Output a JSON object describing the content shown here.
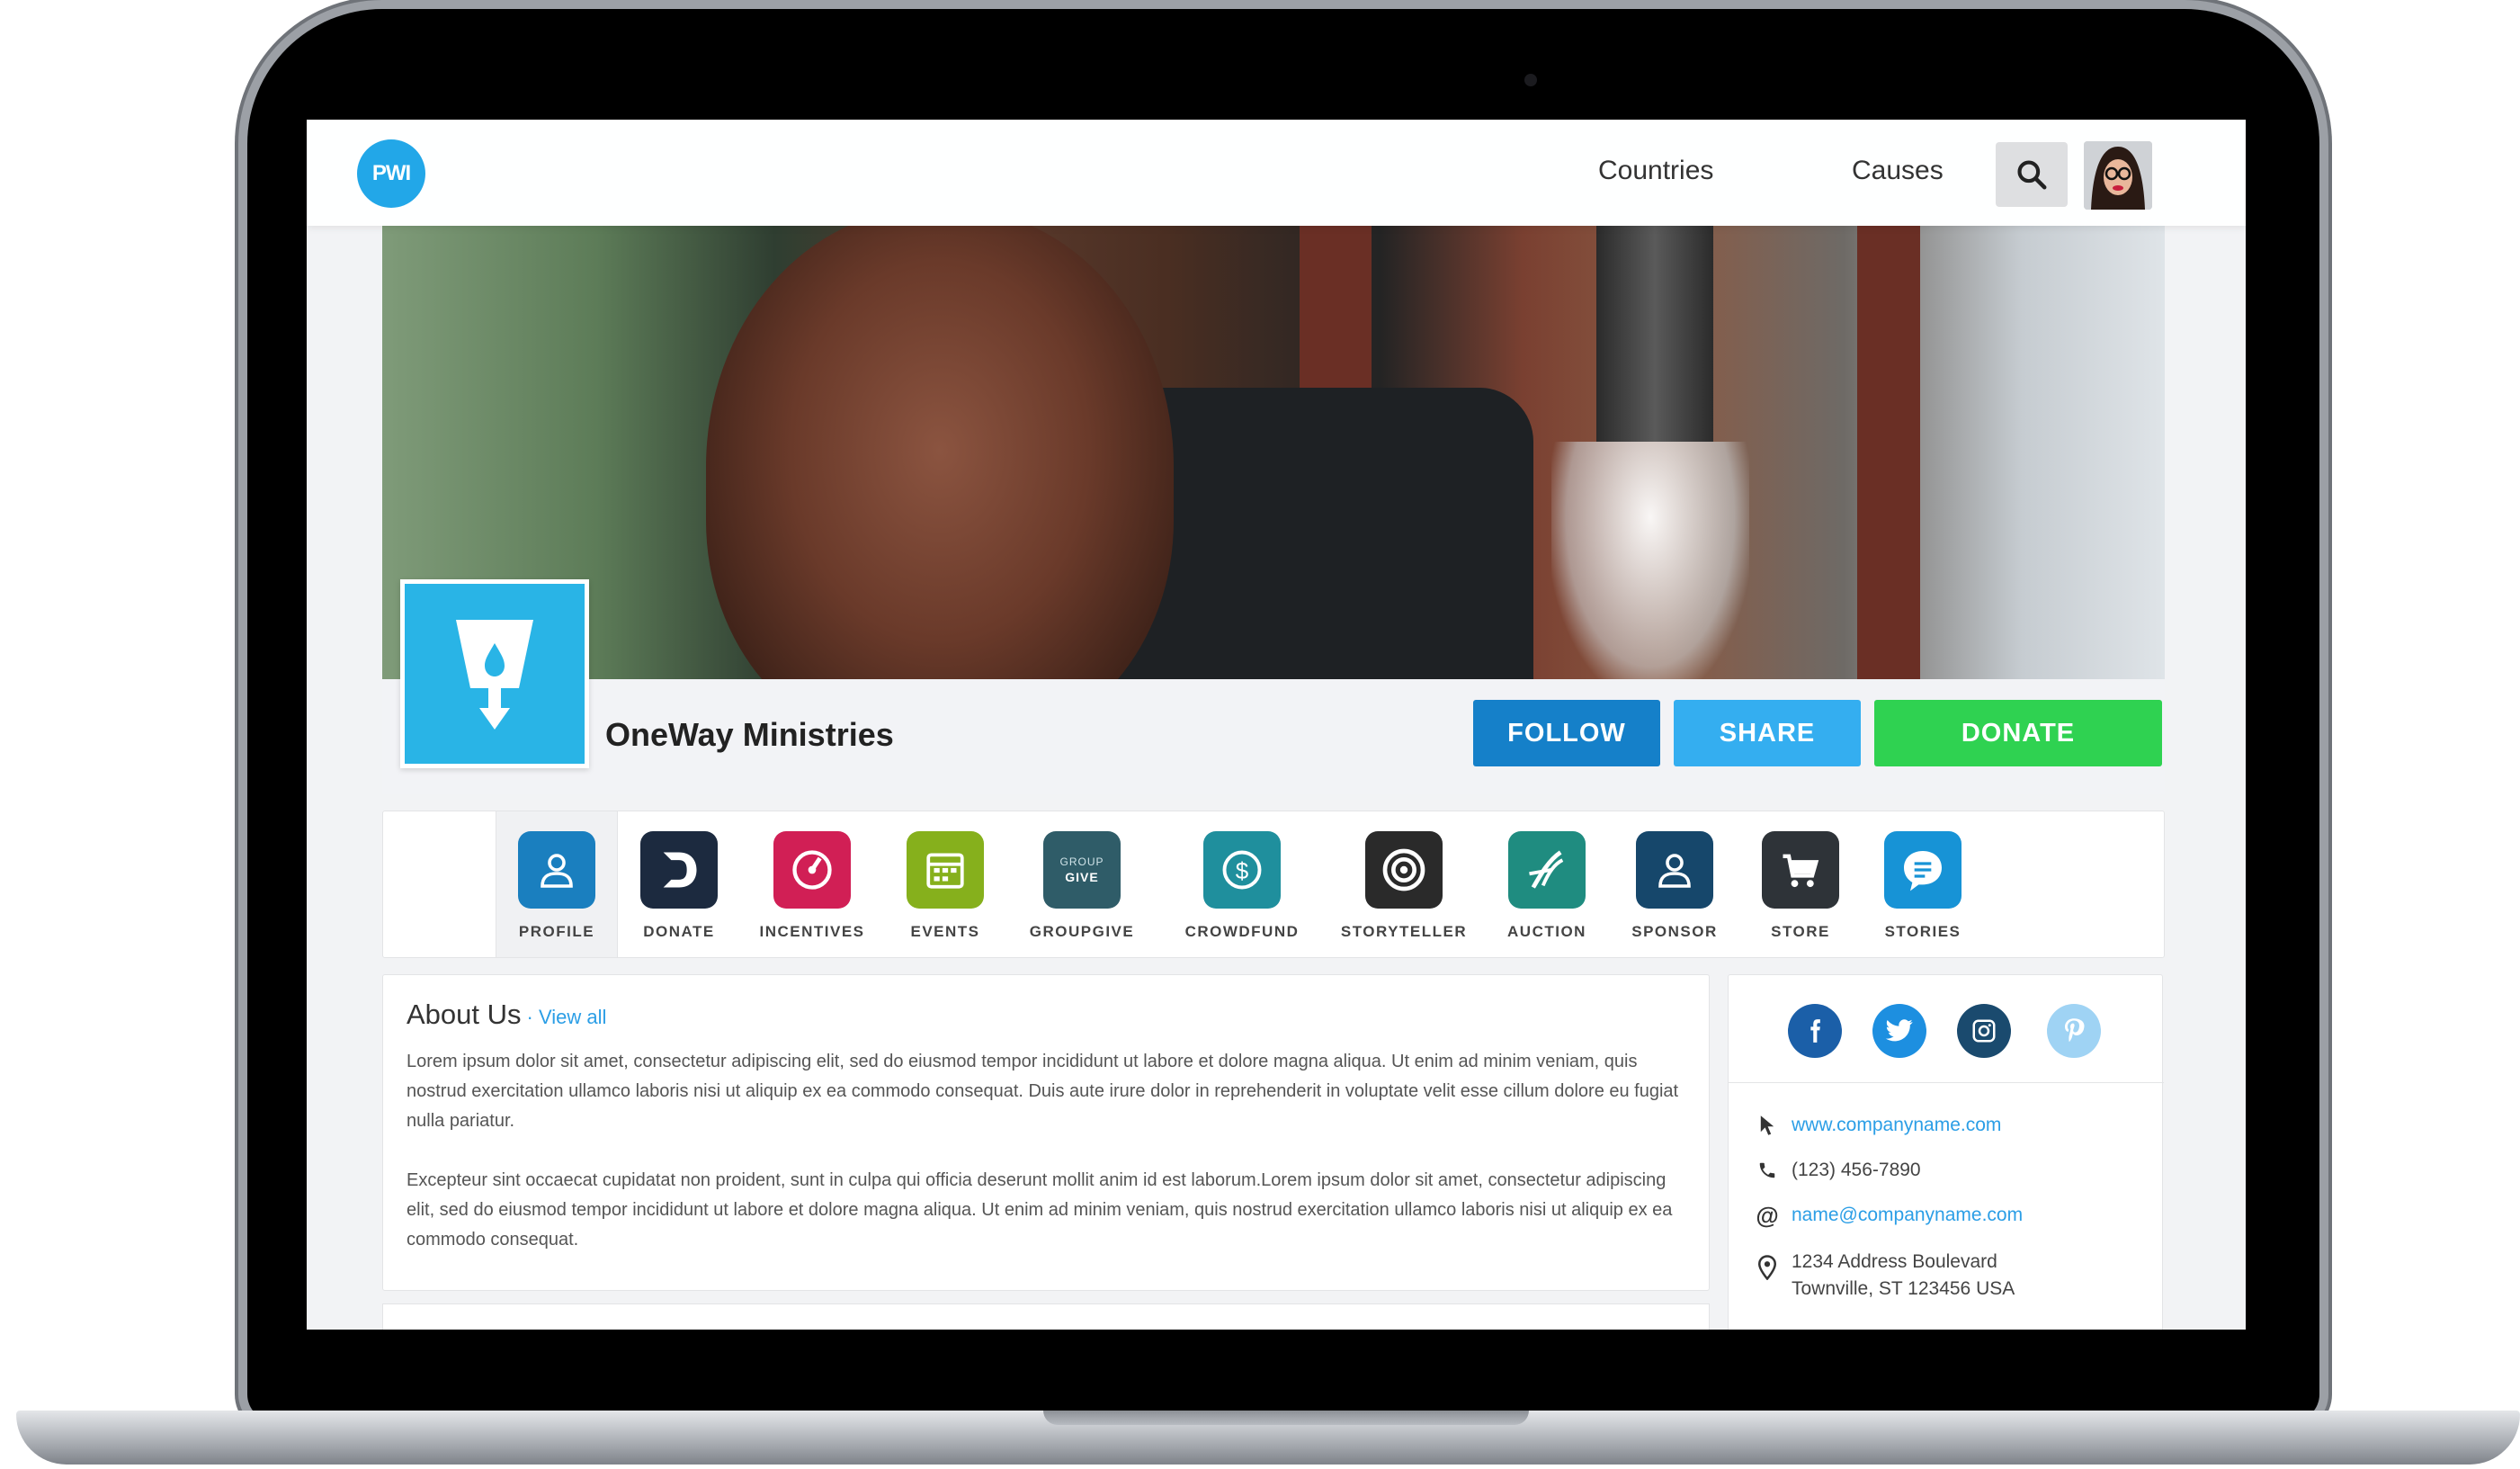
{
  "nav": {
    "logo_text": "PWI",
    "links": [
      "Countries",
      "Causes"
    ],
    "search_icon": "search-icon",
    "avatar": "user-avatar"
  },
  "org": {
    "name": "OneWay Ministries",
    "logo_icon": "water-drop-icon"
  },
  "actions": {
    "follow": "FOLLOW",
    "share": "SHARE",
    "donate": "DONATE"
  },
  "tabs": [
    {
      "label": "PROFILE",
      "icon": "user-icon",
      "color": "#1a7fbf",
      "active": true
    },
    {
      "label": "DONATE",
      "icon": "donate-d-icon",
      "color": "#1c2a3f"
    },
    {
      "label": "INCENTIVES",
      "icon": "gauge-icon",
      "color": "#d11f55"
    },
    {
      "label": "EVENTS",
      "icon": "calendar-icon",
      "color": "#86b01c"
    },
    {
      "label": "GROUPGIVE",
      "icon": "group-give-icon",
      "color": "#2f5c68"
    },
    {
      "label": "CROWDFUND",
      "icon": "dollar-coin-icon",
      "color": "#1f8f9d"
    },
    {
      "label": "STORYTELLER",
      "icon": "target-icon",
      "color": "#2a2a2a"
    },
    {
      "label": "AUCTION",
      "icon": "auction-icon",
      "color": "#1f8c80"
    },
    {
      "label": "SPONSOR",
      "icon": "user-icon",
      "color": "#16476b"
    },
    {
      "label": "STORE",
      "icon": "cart-icon",
      "color": "#2e3338"
    },
    {
      "label": "STORIES",
      "icon": "chat-bubble-icon",
      "color": "#1793d6"
    }
  ],
  "about": {
    "title": "About Us",
    "view_all": "· View all",
    "paragraph1": "Lorem ipsum dolor sit amet, consectetur adipiscing elit, sed do eiusmod tempor incididunt ut labore et dolore magna aliqua. Ut enim ad minim veniam, quis nostrud exercitation ullamco laboris nisi ut aliquip ex ea commodo consequat. Duis aute irure dolor in reprehenderit in voluptate velit esse cillum dolore eu fugiat nulla pariatur.",
    "paragraph2": "Excepteur sint occaecat cupidatat non proident, sunt in culpa qui officia deserunt mollit anim id est laborum.Lorem ipsum dolor sit amet, consectetur adipiscing elit, sed do eiusmod tempor incididunt ut labore et dolore magna aliqua. Ut enim ad minim veniam, quis nostrud exercitation ullamco laboris nisi ut aliquip ex ea commodo consequat."
  },
  "social": [
    {
      "name": "facebook-icon",
      "glyph": "f",
      "color": "#1b5fa8"
    },
    {
      "name": "twitter-icon",
      "glyph": "t",
      "color": "#1d8fe0"
    },
    {
      "name": "instagram-icon",
      "glyph": "◎",
      "color": "#1a4a6e"
    },
    {
      "name": "pinterest-icon",
      "glyph": "p",
      "color": "#9fd3f4"
    }
  ],
  "contact": {
    "website": "www.companyname.com",
    "phone": "(123) 456-7890",
    "email": "name@companyname.com",
    "address_line1": "1234 Address Boulevard",
    "address_line2": "Townville, ST 123456 USA"
  }
}
